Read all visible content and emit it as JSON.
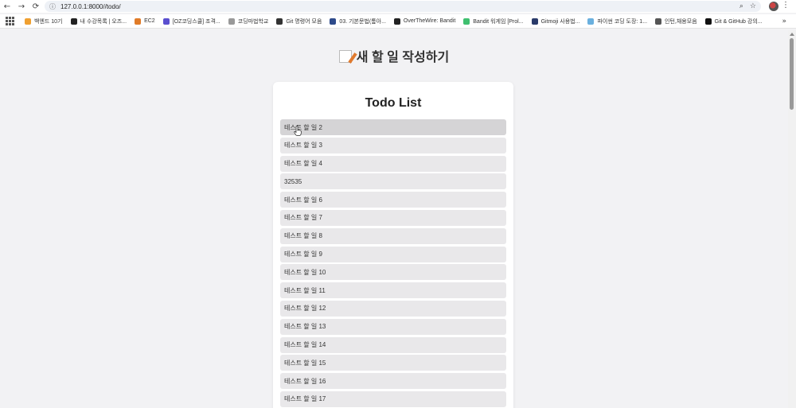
{
  "browser": {
    "url": "127.0.0.1:8000//todo/",
    "nav": {
      "back": "←",
      "forward": "→",
      "reload": "⟳",
      "info": "ⓘ"
    },
    "omni_icons": {
      "zoom": "⌕",
      "star": "☆"
    },
    "menu": "⋮",
    "more_bookmarks": "»"
  },
  "bookmarks": [
    {
      "label": "백엔드 10기",
      "icon": "orange-face-icon",
      "color": "#f0a030"
    },
    {
      "label": "내 수강목록 | 오즈...",
      "icon": "oz-logo-icon",
      "color": "#222222"
    },
    {
      "label": "EC2",
      "icon": "aws-ec2-icon",
      "color": "#e07b28"
    },
    {
      "label": "[OZ코딩스쿨] 조격...",
      "icon": "notion-icon",
      "color": "#5a4fcf"
    },
    {
      "label": "코딩마법학교",
      "icon": "wand-icon",
      "color": "#999999"
    },
    {
      "label": "Git 명령어 모음",
      "icon": "doc-icon",
      "color": "#333333"
    },
    {
      "label": "03. 기본문법(톺아...",
      "icon": "book-icon",
      "color": "#2d4a8a"
    },
    {
      "label": "OverTheWire: Bandit",
      "icon": "terminal-icon",
      "color": "#222222"
    },
    {
      "label": "Bandit 워게임 [Prol...",
      "icon": "green-icon",
      "color": "#3fbf6f"
    },
    {
      "label": "Gitmoji 사용법...",
      "icon": "gitmoji-icon",
      "color": "#2a3b6a"
    },
    {
      "label": "파이썬 코딩 도장: 1...",
      "icon": "python-icon",
      "color": "#6ab0de"
    },
    {
      "label": "인턴,채용모음",
      "icon": "folder-icon",
      "color": "#555555"
    },
    {
      "label": "Git & GitHub 강의...",
      "icon": "github-icon",
      "color": "#111111"
    }
  ],
  "page": {
    "title": "새 할 일 작성하기",
    "card_title": "Todo List"
  },
  "todos": [
    "테스트 할 일 2",
    "테스트 할 일 3",
    "테스트 할 일 4",
    "32535",
    "테스트 할 일 6",
    "테스트 할 일 7",
    "테스트 할 일 8",
    "테스트 할 일 9",
    "테스트 할 일 10",
    "테스트 할 일 11",
    "테스트 할 일 12",
    "테스트 할 일 13",
    "테스트 할 일 14",
    "테스트 할 일 15",
    "테스트 할 일 16",
    "테스트 할 일 17"
  ]
}
